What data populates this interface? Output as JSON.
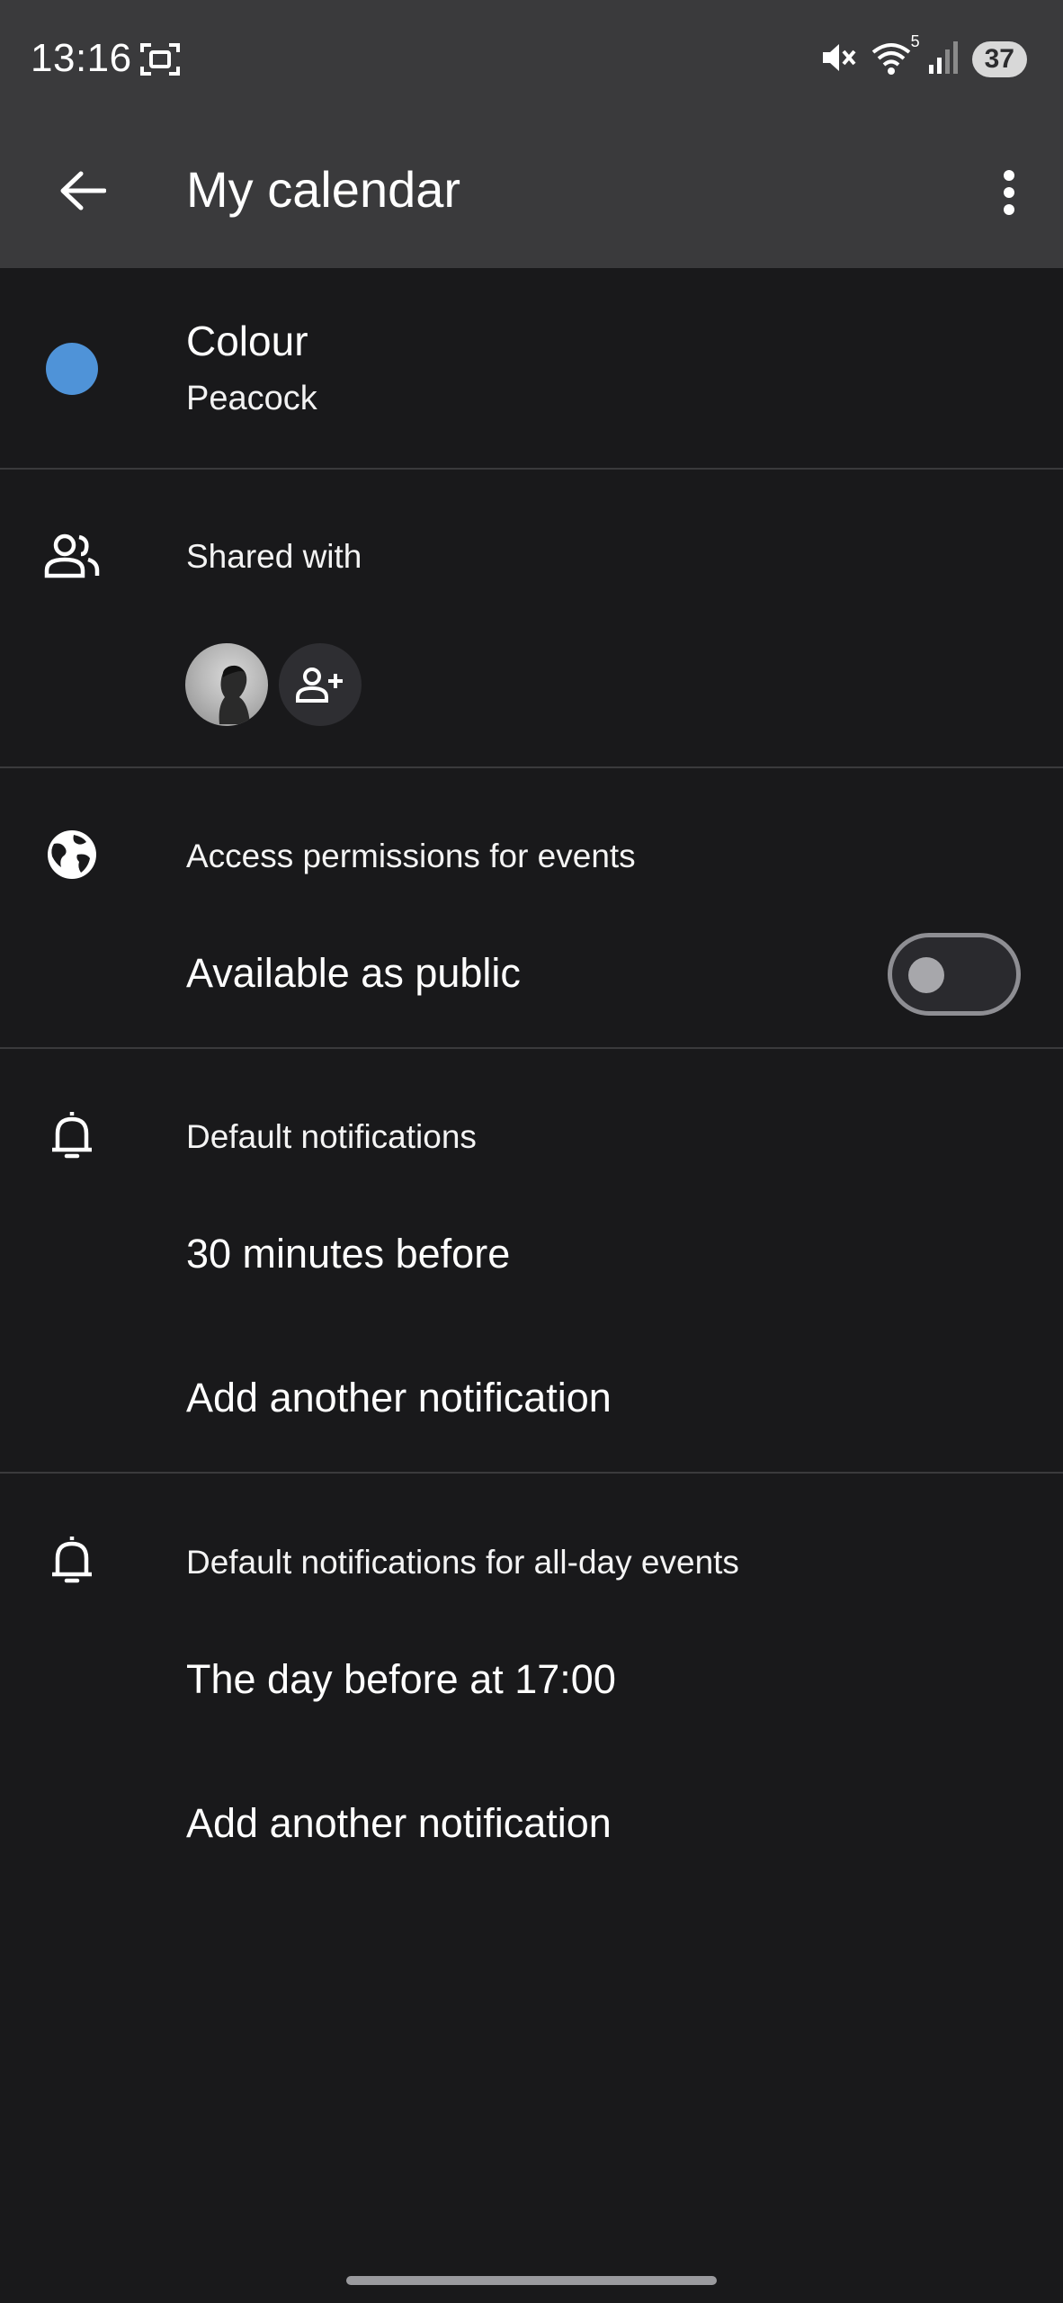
{
  "status_bar": {
    "time": "13:16",
    "battery": "37",
    "wifi_badge": "5"
  },
  "app_bar": {
    "title": "My calendar"
  },
  "colour": {
    "label": "Colour",
    "value": "Peacock",
    "swatch": "#4f93d8"
  },
  "shared": {
    "header": "Shared with"
  },
  "access": {
    "header": "Access permissions for events",
    "public_label": "Available as public",
    "public_enabled": false
  },
  "notifications": {
    "header": "Default notifications",
    "items": [
      "30 minutes before"
    ],
    "add_label": "Add another notification"
  },
  "allday_notifications": {
    "header": "Default notifications for all-day events",
    "items": [
      "The day before at 17:00"
    ],
    "add_label": "Add another notification"
  },
  "colors": {
    "background": "#19191b",
    "app_bar": "#3a3a3c",
    "accent_dot": "#4f93d8"
  }
}
